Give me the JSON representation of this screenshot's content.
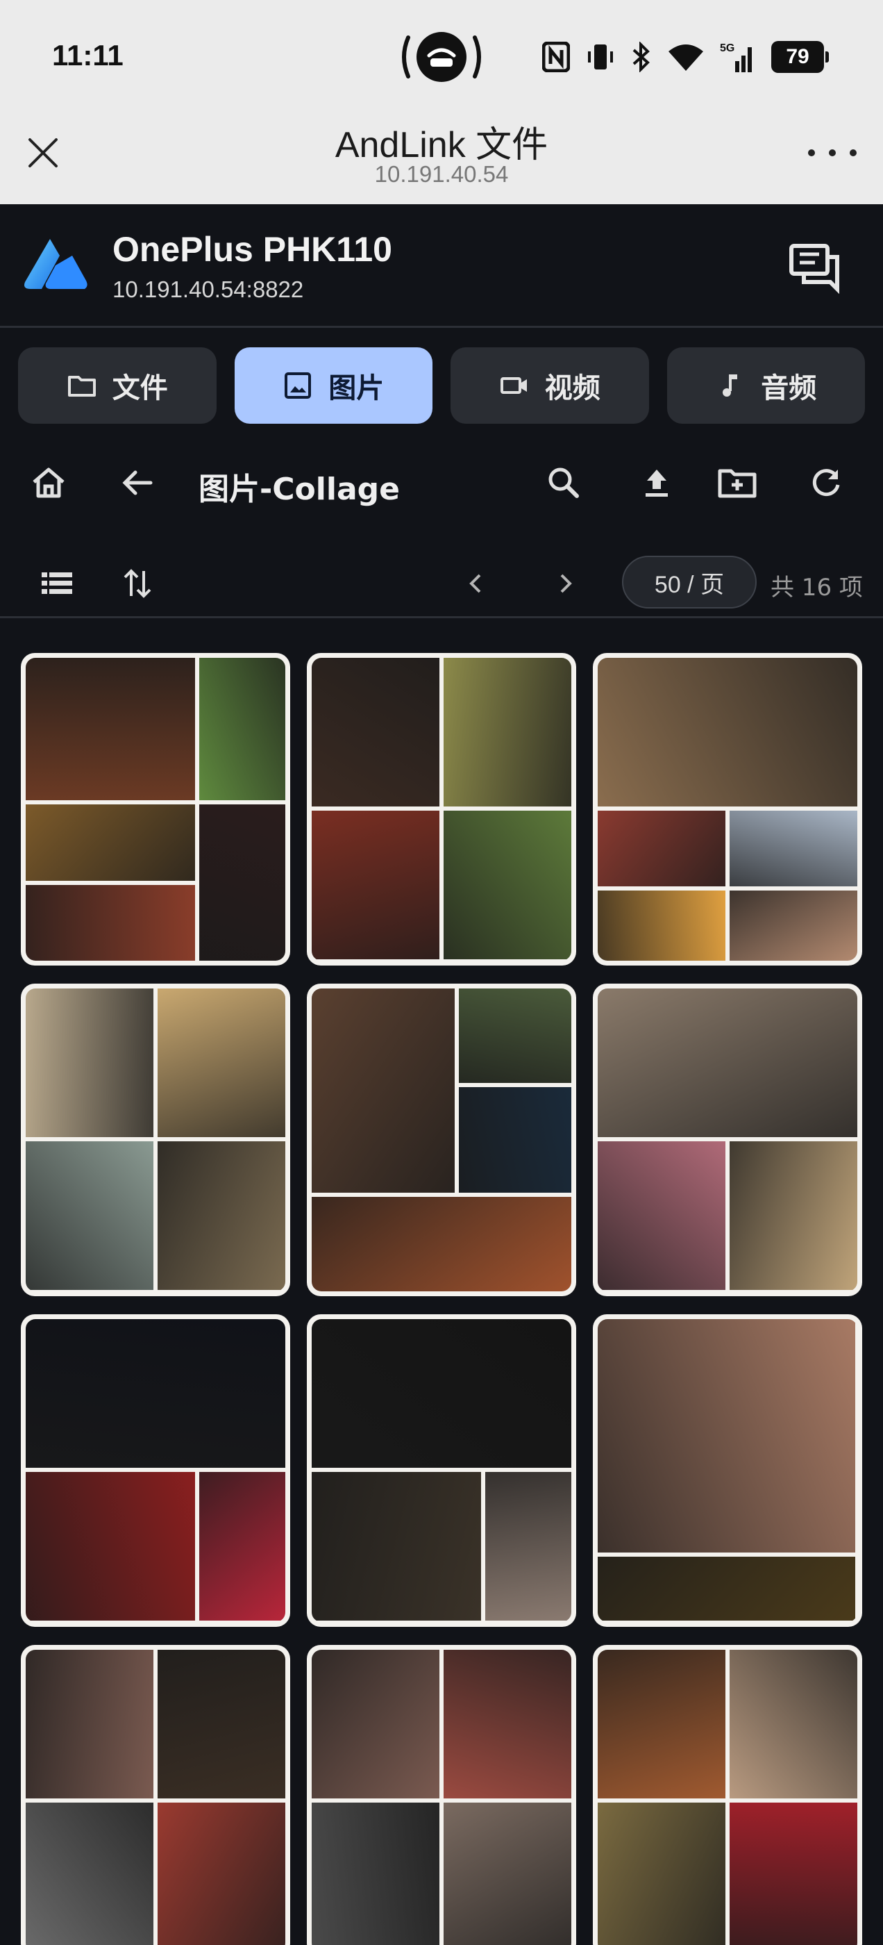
{
  "status": {
    "time": "11:11",
    "battery": "79",
    "network": "5G"
  },
  "browser": {
    "title": "AndLink 文件",
    "url": "10.191.40.54"
  },
  "app": {
    "device_name": "OnePlus PHK110",
    "device_address": "10.191.40.54:8822"
  },
  "tabs": [
    {
      "label": "文件",
      "icon": "folder-icon",
      "active": false
    },
    {
      "label": "图片",
      "icon": "image-icon",
      "active": true
    },
    {
      "label": "视频",
      "icon": "video-icon",
      "active": false
    },
    {
      "label": "音频",
      "icon": "music-note-icon",
      "active": false
    }
  ],
  "toolbar": {
    "folder_title": "图片-Collage"
  },
  "pager": {
    "page_size": "50 / 页",
    "total": "共 16 项"
  },
  "colors": {
    "accent": "#aac7ff",
    "background": "#111318",
    "surface": "#2a2d33"
  },
  "gallery": [
    {
      "name": "collage-1",
      "layout": "a",
      "tiles": [
        "#6b3a24",
        "#5f8a3e",
        "#7c5a2a",
        "#2a1c1c",
        "#8a3d2a"
      ]
    },
    {
      "name": "collage-2",
      "layout": "b",
      "tiles": [
        "#3a2a22",
        "#8c8a4a",
        "#7a2e22",
        "#5d7a3a"
      ]
    },
    {
      "name": "collage-3",
      "layout": "c",
      "tiles": [
        "#8a6d4e",
        "#8a3a30",
        "#a9b6c6",
        "#e0a040",
        "#b38a70"
      ]
    },
    {
      "name": "collage-4",
      "layout": "b",
      "tiles": [
        "#b8a88c",
        "#c9a870",
        "#8a9a92",
        "#7a6a50"
      ]
    },
    {
      "name": "collage-5",
      "layout": "d",
      "tiles": [
        "#5a4030",
        "#4a5a3a",
        "#1a2a3a",
        "#a0522d"
      ]
    },
    {
      "name": "collage-6",
      "layout": "e",
      "tiles": [
        "#8a7a6a",
        "#b06a78",
        "#c0a47a"
      ]
    },
    {
      "name": "collage-7",
      "layout": "f",
      "tiles": [
        "#101218",
        "#8a1f1f",
        "#b8263a"
      ]
    },
    {
      "name": "collage-8",
      "layout": "f",
      "tiles": [
        "#141414",
        "#3a3228",
        "#8a7a70"
      ]
    },
    {
      "name": "collage-9",
      "layout": "g",
      "tiles": [
        "#a87a64",
        "#4a3a1a"
      ]
    },
    {
      "name": "collage-10",
      "layout": "b",
      "tiles": [
        "#7a5a50",
        "#3a2e24",
        "#6a6a6a",
        "#9a3a30"
      ]
    },
    {
      "name": "collage-11",
      "layout": "b",
      "tiles": [
        "#7a5a50",
        "#9a4a40",
        "#4a4a4a",
        "#7a6a60"
      ]
    },
    {
      "name": "collage-12",
      "layout": "b",
      "tiles": [
        "#a05a30",
        "#b89a80",
        "#7a6a40",
        "#a0202a"
      ]
    }
  ]
}
